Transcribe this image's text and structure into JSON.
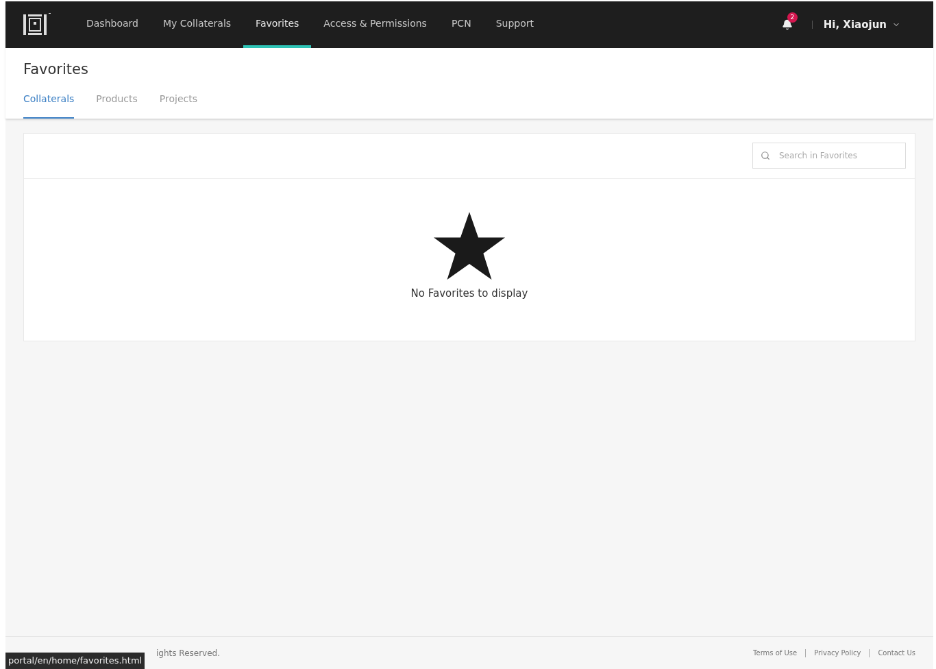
{
  "nav": {
    "items": [
      {
        "label": "Dashboard",
        "selected": false
      },
      {
        "label": "My Collaterals",
        "selected": false
      },
      {
        "label": "Favorites",
        "selected": true
      },
      {
        "label": "Access & Permissions",
        "selected": false
      },
      {
        "label": "PCN",
        "selected": false
      },
      {
        "label": "Support",
        "selected": false
      }
    ],
    "notifications": "2",
    "user": "Hi, Xiaojun"
  },
  "page_title": "Favorites",
  "tabs": [
    {
      "label": "Collaterals",
      "selected": true
    },
    {
      "label": "Products",
      "selected": false
    },
    {
      "label": "Projects",
      "selected": false
    }
  ],
  "search": {
    "placeholder": "Search in Favorites"
  },
  "empty_message": "No Favorites to display",
  "footer": {
    "copyright": "ights Reserved.",
    "links": [
      "Terms of Use",
      "Privacy Policy",
      "Contact Us"
    ]
  },
  "status_url": "portal/en/home/favorites.html"
}
